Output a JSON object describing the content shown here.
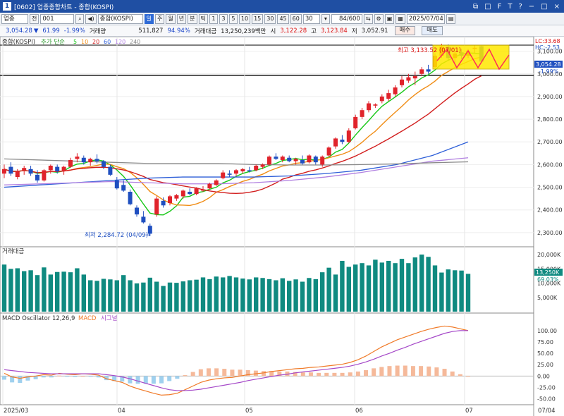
{
  "window": {
    "title": "[0602] 업종종합차트 - 종합(KOSPI)",
    "controls": [
      "⧉",
      "□",
      "F",
      "T",
      "?",
      "−",
      "□",
      "×"
    ]
  },
  "toolbar": {
    "market": "업종",
    "prev": "전",
    "code": "001",
    "name": "종합(KOSPI)",
    "periods": [
      "일",
      "주",
      "월",
      "년",
      "분",
      "틱"
    ],
    "active_period": "일",
    "intervals": [
      "1",
      "3",
      "5",
      "10",
      "15",
      "30",
      "45",
      "60",
      "30"
    ],
    "count": "84/600",
    "date": "2025/07/04"
  },
  "quote": {
    "price": "3,054.28",
    "arrow": "▼",
    "change": "61.99",
    "change_pct": "-1.99%",
    "vol_label": "거래량",
    "volume": "511,827",
    "vol_ratio": "94.94%",
    "amt_label": "거래대금",
    "amount": "13,250,239백만",
    "open_label": "시",
    "open": "3,122.28",
    "high_label": "고",
    "high": "3,123.84",
    "low_label": "저",
    "low": "3,052.91",
    "buy": "매수",
    "sell": "매도"
  },
  "panels": {
    "price": {
      "title": "종합(KOSPI)",
      "ma_label": "추가 단순",
      "ma_periods": [
        5,
        10,
        20,
        60,
        120,
        240
      ],
      "ma_colors": [
        "#19c819",
        "#f08c14",
        "#d21e1e",
        "#2e5fd8",
        "#b07fe0",
        "#8a8a8a"
      ],
      "high_annotation": "최고 3,133.52 (07/01)",
      "low_annotation": "최저 2,284.72 (04/09)",
      "last_price": "3,054.28",
      "last_pct": "-1.99%",
      "lc_label": "LC:33.68",
      "hc_label": "HC:-2.53",
      "y_ticks": [
        "3,100.00",
        "3,000.00",
        "2,900.00",
        "2,800.00",
        "2,700.00",
        "2,600.00",
        "2,500.00",
        "2,400.00",
        "2,300.00"
      ]
    },
    "volume": {
      "title": "거래대금",
      "y_ticks": [
        "20,000K",
        "15,000K",
        "10,000K",
        "5,000K"
      ],
      "last_value": "13,250K",
      "last_pct": "69.03%"
    },
    "macd": {
      "title": "MACD Oscillator 12,26,9",
      "macd_label": "MACD",
      "signal_label": "시그널",
      "y_ticks": [
        "100.00",
        "75.00",
        "50.00",
        "25.00",
        "0.00",
        "-25.00",
        "-50.00"
      ]
    }
  },
  "x_axis": {
    "labels": [
      "2025/03",
      "04",
      "05",
      "06",
      "07"
    ],
    "right_label": "07/04"
  },
  "colors": {
    "up": "#e0232b",
    "down": "#1f4fc0",
    "volume": "#0f8a80",
    "macd": "#f07a28",
    "signal": "#a548c8",
    "osc_pos": "#f5b99a",
    "osc_neg": "#9fd0ee"
  },
  "chart_data": {
    "type": "candlestick",
    "candles": [
      {
        "o": 2560,
        "h": 2600,
        "l": 2540,
        "c": 2580
      },
      {
        "o": 2590,
        "h": 2610,
        "l": 2550,
        "c": 2560
      },
      {
        "o": 2545,
        "h": 2580,
        "l": 2535,
        "c": 2570
      },
      {
        "o": 2575,
        "h": 2595,
        "l": 2555,
        "c": 2585
      },
      {
        "o": 2580,
        "h": 2595,
        "l": 2550,
        "c": 2560
      },
      {
        "o": 2555,
        "h": 2575,
        "l": 2520,
        "c": 2530
      },
      {
        "o": 2530,
        "h": 2580,
        "l": 2525,
        "c": 2575
      },
      {
        "o": 2575,
        "h": 2600,
        "l": 2560,
        "c": 2595
      },
      {
        "o": 2590,
        "h": 2600,
        "l": 2560,
        "c": 2570
      },
      {
        "o": 2570,
        "h": 2595,
        "l": 2555,
        "c": 2590
      },
      {
        "o": 2590,
        "h": 2630,
        "l": 2585,
        "c": 2620
      },
      {
        "o": 2625,
        "h": 2650,
        "l": 2610,
        "c": 2635
      },
      {
        "o": 2630,
        "h": 2640,
        "l": 2600,
        "c": 2610
      },
      {
        "o": 2610,
        "h": 2630,
        "l": 2595,
        "c": 2625
      },
      {
        "o": 2625,
        "h": 2645,
        "l": 2605,
        "c": 2615
      },
      {
        "o": 2615,
        "h": 2620,
        "l": 2580,
        "c": 2590
      },
      {
        "o": 2590,
        "h": 2600,
        "l": 2550,
        "c": 2555
      },
      {
        "o": 2530,
        "h": 2545,
        "l": 2490,
        "c": 2495
      },
      {
        "o": 2510,
        "h": 2530,
        "l": 2480,
        "c": 2485
      },
      {
        "o": 2480,
        "h": 2490,
        "l": 2420,
        "c": 2425
      },
      {
        "o": 2410,
        "h": 2420,
        "l": 2370,
        "c": 2380
      },
      {
        "o": 2370,
        "h": 2395,
        "l": 2340,
        "c": 2345
      },
      {
        "o": 2330,
        "h": 2340,
        "l": 2285,
        "c": 2295
      },
      {
        "o": 2380,
        "h": 2460,
        "l": 2370,
        "c": 2450
      },
      {
        "o": 2440,
        "h": 2455,
        "l": 2410,
        "c": 2420
      },
      {
        "o": 2430,
        "h": 2465,
        "l": 2420,
        "c": 2460
      },
      {
        "o": 2450,
        "h": 2470,
        "l": 2440,
        "c": 2465
      },
      {
        "o": 2460,
        "h": 2490,
        "l": 2450,
        "c": 2485
      },
      {
        "o": 2480,
        "h": 2495,
        "l": 2465,
        "c": 2470
      },
      {
        "o": 2470,
        "h": 2500,
        "l": 2465,
        "c": 2495
      },
      {
        "o": 2485,
        "h": 2505,
        "l": 2480,
        "c": 2490
      },
      {
        "o": 2495,
        "h": 2520,
        "l": 2490,
        "c": 2515
      },
      {
        "o": 2510,
        "h": 2535,
        "l": 2505,
        "c": 2530
      },
      {
        "o": 2540,
        "h": 2575,
        "l": 2535,
        "c": 2565
      },
      {
        "o": 2560,
        "h": 2575,
        "l": 2545,
        "c": 2555
      },
      {
        "o": 2560,
        "h": 2580,
        "l": 2550,
        "c": 2575
      },
      {
        "o": 2570,
        "h": 2585,
        "l": 2560,
        "c": 2580
      },
      {
        "o": 2575,
        "h": 2590,
        "l": 2565,
        "c": 2570
      },
      {
        "o": 2575,
        "h": 2600,
        "l": 2570,
        "c": 2595
      },
      {
        "o": 2590,
        "h": 2605,
        "l": 2580,
        "c": 2600
      },
      {
        "o": 2600,
        "h": 2640,
        "l": 2595,
        "c": 2635
      },
      {
        "o": 2635,
        "h": 2650,
        "l": 2620,
        "c": 2625
      },
      {
        "o": 2620,
        "h": 2640,
        "l": 2610,
        "c": 2635
      },
      {
        "o": 2630,
        "h": 2640,
        "l": 2610,
        "c": 2615
      },
      {
        "o": 2615,
        "h": 2630,
        "l": 2600,
        "c": 2625
      },
      {
        "o": 2620,
        "h": 2640,
        "l": 2600,
        "c": 2605
      },
      {
        "o": 2610,
        "h": 2645,
        "l": 2605,
        "c": 2640
      },
      {
        "o": 2635,
        "h": 2640,
        "l": 2600,
        "c": 2610
      },
      {
        "o": 2600,
        "h": 2640,
        "l": 2590,
        "c": 2635
      },
      {
        "o": 2640,
        "h": 2680,
        "l": 2635,
        "c": 2675
      },
      {
        "o": 2680,
        "h": 2720,
        "l": 2670,
        "c": 2715
      },
      {
        "o": 2710,
        "h": 2730,
        "l": 2690,
        "c": 2700
      },
      {
        "o": 2700,
        "h": 2760,
        "l": 2695,
        "c": 2750
      },
      {
        "o": 2760,
        "h": 2820,
        "l": 2755,
        "c": 2810
      },
      {
        "o": 2810,
        "h": 2850,
        "l": 2800,
        "c": 2840
      },
      {
        "o": 2840,
        "h": 2880,
        "l": 2830,
        "c": 2870
      },
      {
        "o": 2860,
        "h": 2870,
        "l": 2850,
        "c": 2865
      },
      {
        "o": 2880,
        "h": 2910,
        "l": 2870,
        "c": 2900
      },
      {
        "o": 2890,
        "h": 2930,
        "l": 2880,
        "c": 2915
      },
      {
        "o": 2910,
        "h": 2950,
        "l": 2900,
        "c": 2940
      },
      {
        "o": 2950,
        "h": 2990,
        "l": 2940,
        "c": 2975
      },
      {
        "o": 2970,
        "h": 3000,
        "l": 2960,
        "c": 2985
      },
      {
        "o": 2980,
        "h": 3010,
        "l": 2950,
        "c": 2990
      },
      {
        "o": 3000,
        "h": 3030,
        "l": 2990,
        "c": 3020
      },
      {
        "o": 3020,
        "h": 3040,
        "l": 3000,
        "c": 3010
      },
      {
        "o": 3030,
        "h": 3090,
        "l": 3025,
        "c": 3080
      },
      {
        "o": 3080,
        "h": 3133,
        "l": 3070,
        "c": 3120
      },
      {
        "o": 3120,
        "h": 3130,
        "l": 3060,
        "c": 3070
      },
      {
        "o": 3070,
        "h": 3100,
        "l": 3050,
        "c": 3090
      },
      {
        "o": 3095,
        "h": 3110,
        "l": 3065,
        "c": 3080
      },
      {
        "o": 3080,
        "h": 3110,
        "l": 3070,
        "c": 3100
      },
      {
        "o": 3110,
        "h": 3125,
        "l": 3090,
        "c": 3115
      },
      {
        "o": 3122,
        "h": 3124,
        "l": 3052,
        "c": 3054
      }
    ],
    "volume_k": [
      16500,
      15000,
      15200,
      14200,
      14500,
      12800,
      15500,
      13000,
      13900,
      14000,
      13800,
      15200,
      13000,
      11000,
      10800,
      11500,
      11300,
      11000,
      12800,
      11000,
      9900,
      10200,
      11900,
      10500,
      9000,
      10200,
      10100,
      10600,
      11000,
      11200,
      12000,
      11400,
      12300,
      12000,
      12500,
      12000,
      11600,
      11300,
      12000,
      11800,
      11400,
      11000,
      11700,
      10800,
      11300,
      10500,
      11800,
      11400,
      13800,
      15400,
      13000,
      17800,
      15700,
      16500,
      17000,
      16200,
      18200,
      17200,
      17800,
      17000,
      18500,
      17000,
      19000,
      20000,
      19200,
      16200,
      13700,
      14800,
      14500,
      14400,
      13250
    ],
    "macd": [
      6,
      -2,
      -5,
      -2,
      0,
      3,
      2,
      6,
      4,
      3,
      5,
      4,
      2,
      -6,
      -10,
      -14,
      -22,
      -28,
      -33,
      -38,
      -42,
      -41,
      -38,
      -30,
      -22,
      -14,
      -9,
      -6,
      -4,
      -3,
      0,
      3,
      5,
      7,
      10,
      12,
      14,
      16,
      17,
      19,
      20,
      22,
      24,
      26,
      30,
      36,
      44,
      54,
      64,
      72,
      80,
      86,
      92,
      98,
      103,
      107,
      110,
      108,
      104,
      100
    ],
    "signal": [
      14,
      12,
      10,
      8,
      7,
      6,
      5,
      5,
      5,
      5,
      5,
      5,
      5,
      3,
      1,
      -2,
      -6,
      -11,
      -16,
      -21,
      -26,
      -30,
      -32,
      -32,
      -31,
      -29,
      -26,
      -23,
      -20,
      -17,
      -14,
      -10,
      -7,
      -4,
      -1,
      2,
      4,
      7,
      9,
      11,
      13,
      15,
      17,
      19,
      22,
      26,
      31,
      37,
      44,
      50,
      57,
      63,
      70,
      76,
      82,
      88,
      94,
      98,
      100,
      100
    ]
  }
}
